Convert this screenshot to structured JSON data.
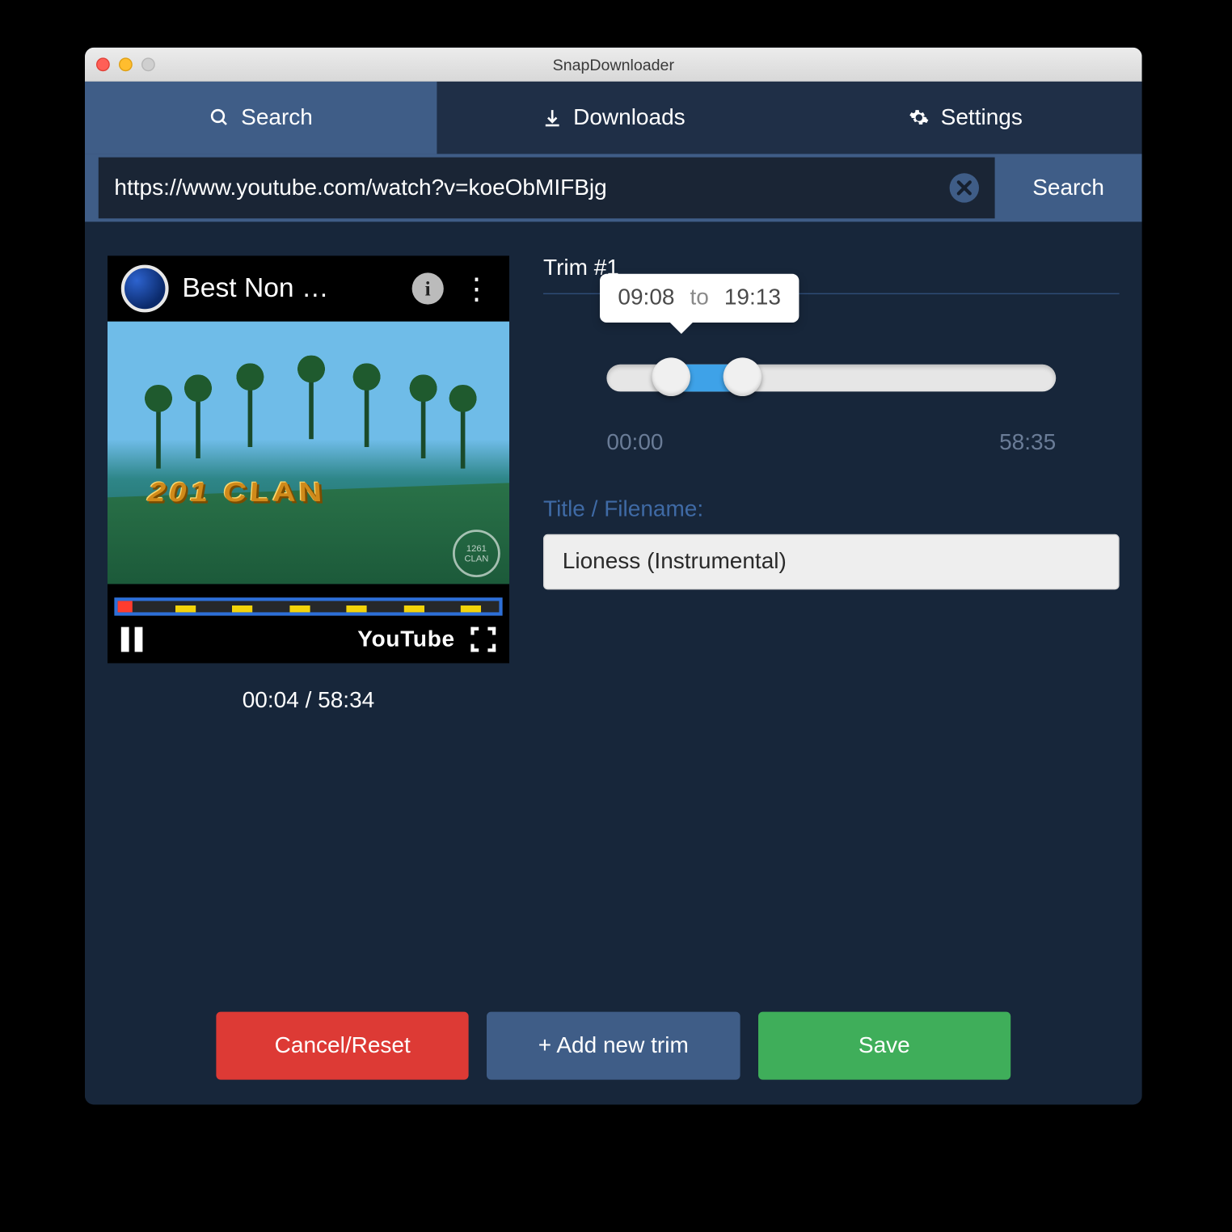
{
  "window": {
    "title": "SnapDownloader"
  },
  "tabs": {
    "search": "Search",
    "downloads": "Downloads",
    "settings": "Settings",
    "active": "search"
  },
  "searchbar": {
    "url": "https://www.youtube.com/watch?v=koeObMIFBjg",
    "search_label": "Search"
  },
  "player": {
    "video_title": "Best Non …",
    "brand": "YouTube",
    "current_time": "00:04",
    "total_time": "58:34",
    "sand_text": "201 CLAN",
    "watermark": "1261 CLAN"
  },
  "trim": {
    "heading": "Trim #1",
    "from": "09:08",
    "to_word": "to",
    "to": "19:13",
    "range_start": "00:00",
    "range_end": "58:35",
    "filename_label": "Title / Filename:",
    "filename_value": "Lioness (Instrumental)"
  },
  "buttons": {
    "cancel": "Cancel/Reset",
    "add": "+ Add new trim",
    "save": "Save"
  },
  "colors": {
    "accent": "#3f5d87",
    "danger": "#dd3a35",
    "success": "#3fae5a",
    "bg_dark": "#17263a"
  }
}
